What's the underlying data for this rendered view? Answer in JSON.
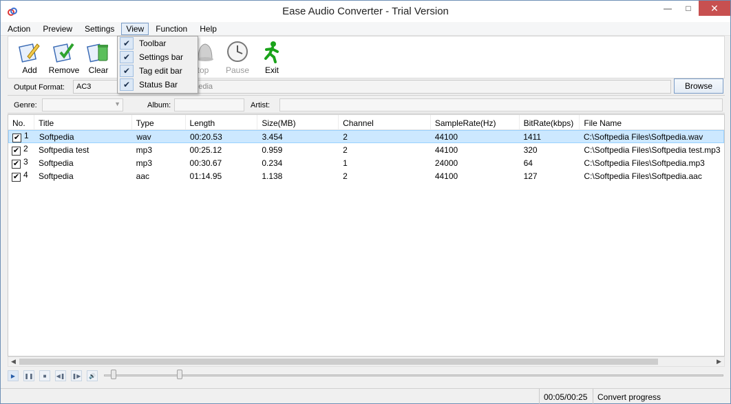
{
  "window": {
    "title": "Ease Audio Converter - Trial Version",
    "controls": [
      "minimize",
      "maximize",
      "close"
    ]
  },
  "menubar": {
    "items": [
      "Action",
      "Preview",
      "Settings",
      "View",
      "Function",
      "Help"
    ],
    "active": "View"
  },
  "view_menu": {
    "items": [
      {
        "label": "Toolbar",
        "checked": true
      },
      {
        "label": "Settings bar",
        "checked": true
      },
      {
        "label": "Tag edit bar",
        "checked": true
      },
      {
        "label": "Status Bar",
        "checked": true
      }
    ]
  },
  "toolbar": {
    "add": "Add",
    "remove": "Remove",
    "clear": "Clear",
    "stop": "Stop",
    "pause": "Pause",
    "exit": "Exit",
    "stop_partial": "top"
  },
  "settings": {
    "output_format_label": "Output Format:",
    "output_format_value": "AC3",
    "output_path_partial": "ftpedia",
    "browse_label": "Browse"
  },
  "tags": {
    "genre_label": "Genre:",
    "album_label": "Album:",
    "artist_label": "Artist:"
  },
  "table": {
    "columns": [
      "No.",
      "Title",
      "Type",
      "Length",
      "Size(MB)",
      "Channel",
      "SampleRate(Hz)",
      "BitRate(kbps)",
      "File Name"
    ],
    "rows": [
      {
        "no": "1",
        "title": "Softpedia",
        "type": "wav",
        "length": "00:20.53",
        "size": "3.454",
        "channel": "2",
        "samplerate": "44100",
        "bitrate": "1411",
        "file": "C:\\Softpedia Files\\Softpedia.wav",
        "checked": true,
        "selected": true
      },
      {
        "no": "2",
        "title": "Softpedia test",
        "type": "mp3",
        "length": "00:25.12",
        "size": "0.959",
        "channel": "2",
        "samplerate": "44100",
        "bitrate": "320",
        "file": "C:\\Softpedia Files\\Softpedia test.mp3",
        "checked": true,
        "selected": false
      },
      {
        "no": "3",
        "title": "Softpedia",
        "type": "mp3",
        "length": "00:30.67",
        "size": "0.234",
        "channel": "1",
        "samplerate": "24000",
        "bitrate": "64",
        "file": "C:\\Softpedia Files\\Softpedia.mp3",
        "checked": true,
        "selected": false
      },
      {
        "no": "4",
        "title": "Softpedia",
        "type": "aac",
        "length": "01:14.95",
        "size": "1.138",
        "channel": "2",
        "samplerate": "44100",
        "bitrate": "127",
        "file": "C:\\Softpedia Files\\Softpedia.aac",
        "checked": true,
        "selected": false
      }
    ]
  },
  "status": {
    "time": "00:05/00:25",
    "progress_label": "Convert progress"
  },
  "colors": {
    "selection": "#cce8ff",
    "close_button": "#c75050",
    "exit_icon": "#1aa31a"
  }
}
